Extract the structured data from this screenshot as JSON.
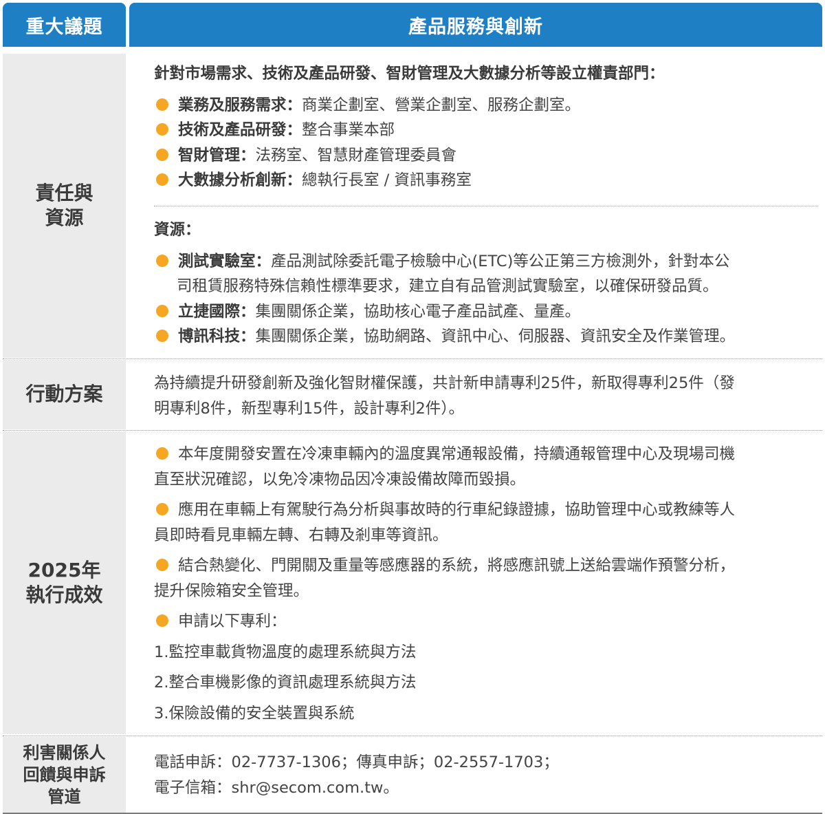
{
  "header": {
    "col_issue": "重大議題",
    "col_topic": "產品服務與創新"
  },
  "rows": {
    "responsibility": {
      "label_lines": [
        "責任與",
        "資源"
      ],
      "dept_title": "針對市場需求、技術及產品研發、智財管理及大數據分析等設立權責部門：",
      "depts": [
        {
          "term": "業務及服務需求：",
          "text": "商業企劃室、營業企劃室、服務企劃室。"
        },
        {
          "term": "技術及產品研發：",
          "text": "整合事業本部"
        },
        {
          "term": "智財管理：",
          "text": "法務室、智慧財產管理委員會"
        },
        {
          "term": "大數據分析創新：",
          "text": "總執行長室 / 資訊事務室"
        }
      ],
      "res_title": "資源：",
      "resources": [
        {
          "term": "測試實驗室：",
          "line1": "產品測試除委託電子檢驗中心(ETC)等公正第三方檢測外，針對本公",
          "line2": "司租賃服務特殊信賴性標準要求，建立自有品管測試實驗室，以確保研發品質。"
        },
        {
          "term": "立捷國際：",
          "line1": "集團關係企業，協助核心電子產品試產、量產。"
        },
        {
          "term": "博訊科技：",
          "line1": "集團關係企業，協助網路、資訊中心、伺服器、資訊安全及作業管理。"
        }
      ]
    },
    "action": {
      "label": "行動方案",
      "line1": "為持續提升研發創新及強化智財權保護，共計新申請專利25件，新取得專利25件（發",
      "line2": "明專利8件，新型專利15件，設計專利2件）。"
    },
    "results": {
      "label_lines": [
        "2025年",
        "執行成效"
      ],
      "items": [
        {
          "line1": "本年度開發安置在冷凍車輛內的溫度異常通報設備，持續通報管理中心及現場司機",
          "line2": "直至狀況確認，以免冷凍物品因冷凍設備故障而毀損。"
        },
        {
          "line1": "應用在車輛上有駕駛行為分析與事故時的行車紀錄證據，協助管理中心或教練等人",
          "line2": "員即時看見車輛左轉、右轉及剎車等資訊。"
        },
        {
          "line1": "結合熱變化、門開關及重量等感應器的系統，將感應訊號上送給雲端作預警分析，",
          "line2": "提升保險箱安全管理。"
        },
        {
          "line1": "申請以下專利："
        }
      ],
      "patents": [
        "1.監控車載貨物溫度的處理系統與方法",
        "2.整合車機影像的資訊處理系統與方法",
        "3.保險設備的安全裝置與系統"
      ]
    },
    "stakeholder": {
      "label_lines": [
        "利害關係人",
        "回饋與申訴",
        "管道"
      ],
      "line1": "電話申訴：02-7737-1306；傳真申訴；02-2557-1703；",
      "line2": "電子信箱：shr@secom.com.tw。"
    }
  },
  "colors": {
    "header_blue": "#1e7fc4",
    "label_gray": "#ebebeb",
    "bullet_orange": "#f5a623"
  }
}
